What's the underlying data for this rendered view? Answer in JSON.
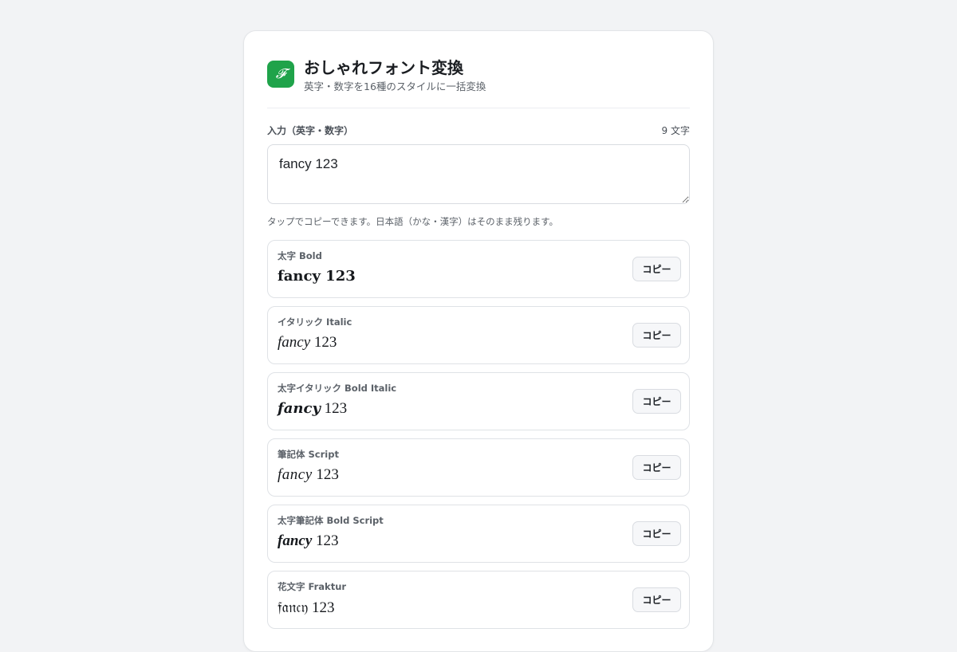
{
  "app": {
    "logo_glyph": "𝓕",
    "title": "おしゃれフォント変換",
    "subtitle": "英字・数字を16種のスタイルに一括変換"
  },
  "input": {
    "label": "入力（英字・数字）",
    "char_count": "9 文字",
    "value": "fancy 123"
  },
  "hint": "タップでコピーできます。日本語（かな・漢字）はそのまま残ります。",
  "copy_label": "コピー",
  "results": [
    {
      "label": "太字 Bold",
      "value": "fancy 123"
    },
    {
      "label": "イタリック Italic",
      "value": "fancy 123"
    },
    {
      "label": "太字イタリック Bold Italic",
      "value": "fancy 123"
    },
    {
      "label": "筆記体 Script",
      "value": "fancy 123"
    },
    {
      "label": "太字筆記体 Bold Script",
      "value": "fancy 123"
    },
    {
      "label": "花文字 Fraktur",
      "value": "fancy 123"
    }
  ],
  "colors": {
    "accent": "#1fa34a",
    "background": "#f2f3f5"
  }
}
